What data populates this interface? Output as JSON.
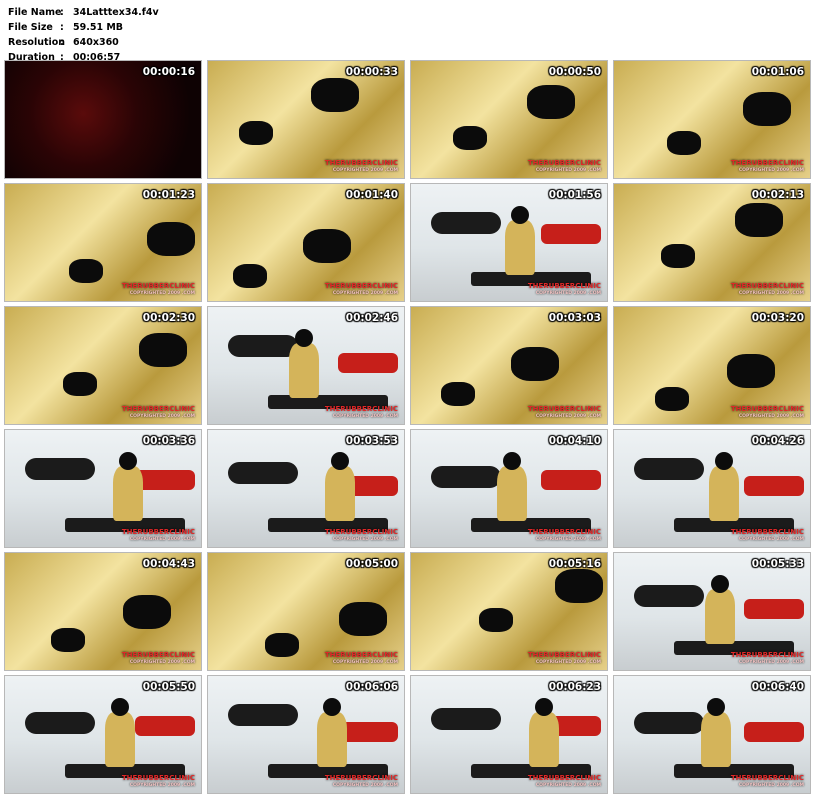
{
  "info": {
    "rows": [
      {
        "label": "File Name",
        "value": "34Latttex34.f4v"
      },
      {
        "label": "File Size",
        "value": "59.51 MB"
      },
      {
        "label": "Resolution",
        "value": "640x360"
      },
      {
        "label": "Duration",
        "value": "00:06:57"
      }
    ],
    "separator": ":"
  },
  "thumbnails": [
    {
      "time": "00:00:16",
      "scene": "dark"
    },
    {
      "time": "00:00:33",
      "scene": "latex-close"
    },
    {
      "time": "00:00:50",
      "scene": "latex-close"
    },
    {
      "time": "00:01:06",
      "scene": "latex-close"
    },
    {
      "time": "00:01:23",
      "scene": "latex-close"
    },
    {
      "time": "00:01:40",
      "scene": "latex-close"
    },
    {
      "time": "00:01:56",
      "scene": "room"
    },
    {
      "time": "00:02:13",
      "scene": "latex-close"
    },
    {
      "time": "00:02:30",
      "scene": "latex-close"
    },
    {
      "time": "00:02:46",
      "scene": "room"
    },
    {
      "time": "00:03:03",
      "scene": "latex-close"
    },
    {
      "time": "00:03:20",
      "scene": "latex-close"
    },
    {
      "time": "00:03:36",
      "scene": "room"
    },
    {
      "time": "00:03:53",
      "scene": "room"
    },
    {
      "time": "00:04:10",
      "scene": "room"
    },
    {
      "time": "00:04:26",
      "scene": "room"
    },
    {
      "time": "00:04:43",
      "scene": "latex-close"
    },
    {
      "time": "00:05:00",
      "scene": "latex-close"
    },
    {
      "time": "00:05:16",
      "scene": "latex-close"
    },
    {
      "time": "00:05:33",
      "scene": "room"
    },
    {
      "time": "00:05:50",
      "scene": "room"
    },
    {
      "time": "00:06:06",
      "scene": "room"
    },
    {
      "time": "00:06:23",
      "scene": "room"
    },
    {
      "time": "00:06:40",
      "scene": "room"
    }
  ],
  "watermark": {
    "brand": "THERUBBERCLINIC",
    "copyright": "COPYRIGHTED 2009 .COM"
  },
  "colors": {
    "timestamp": "#ffffff",
    "watermark": "#e02828",
    "background": "#ffffff"
  }
}
